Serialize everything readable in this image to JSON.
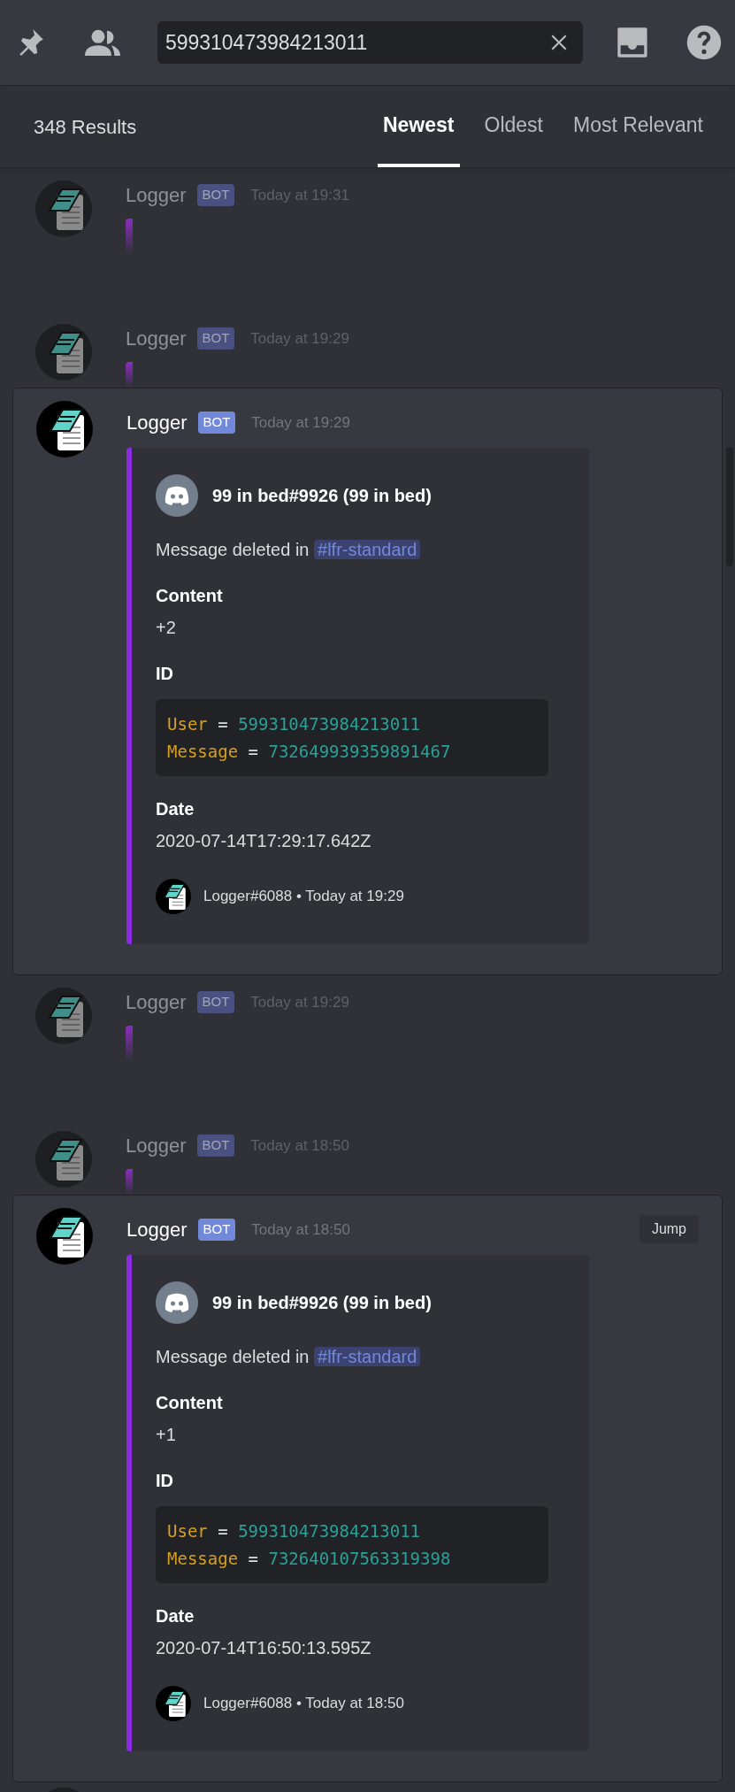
{
  "toolbar": {
    "search": {
      "value": "599310473984213011"
    }
  },
  "results": {
    "count": "348 Results",
    "tabs": [
      {
        "label": "Newest",
        "selected": true
      },
      {
        "label": "Oldest",
        "selected": false
      },
      {
        "label": "Most Relevant",
        "selected": false
      }
    ]
  },
  "messages": [
    {
      "kind": "faded",
      "author": "Logger",
      "badge": "BOT",
      "time": "Today at 19:31"
    },
    {
      "kind": "faded",
      "author": "Logger",
      "badge": "BOT",
      "time": "Today at 19:29"
    },
    {
      "kind": "card",
      "author": "Logger",
      "badge": "BOT",
      "time": "Today at 19:29",
      "embed": {
        "author": "99 in bed#9926 (99 in bed)",
        "description": "Message deleted in",
        "channel": "#lfr-standard",
        "fields": [
          {
            "kind": "text",
            "name": "Content",
            "value": "+2"
          },
          {
            "kind": "code",
            "name": "ID",
            "lines": [
              {
                "key": "User",
                "op": "=",
                "value": "599310473984213011"
              },
              {
                "key": "Message",
                "op": "=",
                "value": "732649939359891467"
              }
            ]
          },
          {
            "kind": "text",
            "name": "Date",
            "value": "2020-07-14T17:29:17.642Z"
          }
        ],
        "footer": {
          "text": "Logger#6088",
          "separator": "•",
          "time": "Today at 19:29"
        }
      }
    },
    {
      "kind": "faded",
      "author": "Logger",
      "badge": "BOT",
      "time": "Today at 19:29"
    },
    {
      "kind": "faded",
      "author": "Logger",
      "badge": "BOT",
      "time": "Today at 18:50"
    },
    {
      "kind": "card",
      "author": "Logger",
      "badge": "BOT",
      "time": "Today at 18:50",
      "jump": "Jump",
      "embed": {
        "author": "99 in bed#9926 (99 in bed)",
        "description": "Message deleted in",
        "channel": "#lfr-standard",
        "fields": [
          {
            "kind": "text",
            "name": "Content",
            "value": "+1"
          },
          {
            "kind": "code",
            "name": "ID",
            "lines": [
              {
                "key": "User",
                "op": "=",
                "value": "599310473984213011"
              },
              {
                "key": "Message",
                "op": "=",
                "value": "732640107563319398"
              }
            ]
          },
          {
            "kind": "text",
            "name": "Date",
            "value": "2020-07-14T16:50:13.595Z"
          }
        ],
        "footer": {
          "text": "Logger#6088",
          "separator": "•",
          "time": "Today at 18:50"
        }
      }
    },
    {
      "kind": "partial"
    }
  ]
}
